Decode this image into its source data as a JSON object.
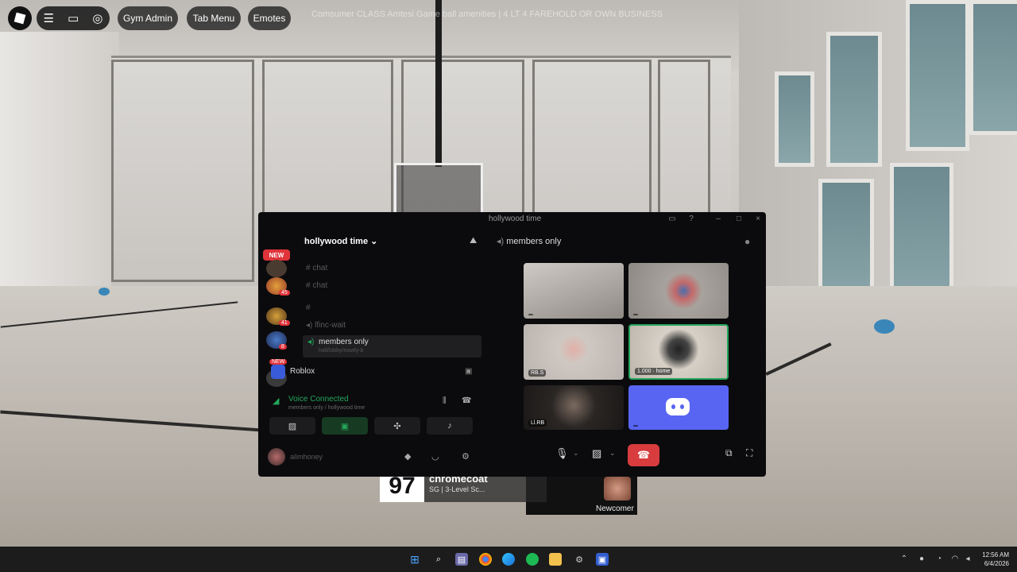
{
  "roblox": {
    "buttons": [
      "Gym Admin",
      "Tab Menu",
      "Emotes"
    ],
    "icons": [
      "roblox-logo-icon",
      "hamburger-icon",
      "chat-icon",
      "emote-wheel-icon"
    ],
    "top_text": "Comsumer CLASS Amtesi Game ball amenities | 4 LT 4 FAREHOLD OR OWN BUSINESS"
  },
  "player_card": {
    "number": "97",
    "name": "chromecoat",
    "subtitle": "SG | 3-Level Sc...",
    "rank": "Newcomer"
  },
  "discord": {
    "window_title": "hollywood time",
    "new_tag": "NEW",
    "guild_badges": [
      "45",
      "41",
      "8",
      "NEW"
    ],
    "server_name": "hollywood time",
    "channels": [
      "chat",
      "chat",
      "",
      "lfinc-wait"
    ],
    "active_channel": "members only",
    "active_channel_sub": "hall/lobby/rowdy-b",
    "app_row": "Roblox",
    "voice_status": "Voice Connected",
    "voice_sub": "members only / hollywood time",
    "user_name": "alimhoney",
    "vc_header": "members only",
    "tiles": [
      {
        "label": ""
      },
      {
        "label": ""
      },
      {
        "label": "RB.S"
      },
      {
        "label": "1.000 · home"
      },
      {
        "label": "Ll.RB"
      },
      {
        "label": ""
      }
    ],
    "colors": {
      "accent": "#5865f2",
      "danger": "#d83c3e",
      "speaking": "#23a55a",
      "bg": "#0b0b0d"
    }
  },
  "taskbar": {
    "icons": [
      "windows-start-icon",
      "search-icon",
      "task-view-icon",
      "chrome-icon",
      "edge-icon",
      "spotify-icon",
      "file-explorer-icon",
      "settings-icon",
      "roblox-icon"
    ],
    "time": "12:56 AM",
    "date": "6/4/2026"
  }
}
